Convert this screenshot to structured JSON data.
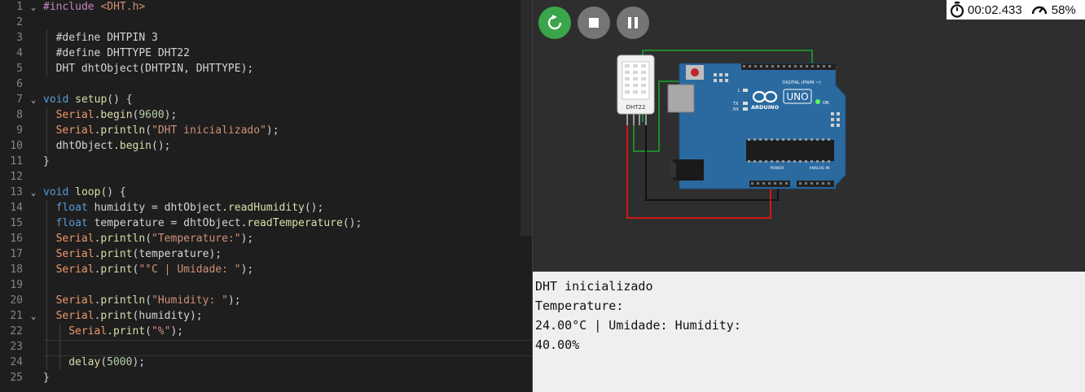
{
  "editor": {
    "line_numbers": [
      "1",
      "2",
      "3",
      "4",
      "5",
      "6",
      "7",
      "8",
      "9",
      "10",
      "11",
      "12",
      "13",
      "14",
      "15",
      "16",
      "17",
      "18",
      "19",
      "20",
      "21",
      "22",
      "23",
      "24",
      "25"
    ],
    "fold_lines": [
      1,
      7,
      13,
      21
    ],
    "lines": [
      {
        "indent": 0,
        "tokens": [
          [
            "inc",
            "#include "
          ],
          [
            "str",
            "<DHT.h>"
          ]
        ]
      },
      {
        "indent": 0,
        "tokens": []
      },
      {
        "indent": 1,
        "tokens": [
          [
            "pl",
            "#define DHTPIN 3"
          ]
        ]
      },
      {
        "indent": 1,
        "tokens": [
          [
            "pl",
            "#define DHTTYPE DHT22"
          ]
        ]
      },
      {
        "indent": 1,
        "tokens": [
          [
            "pl",
            "DHT dhtObject(DHTPIN, DHTTYPE);"
          ]
        ]
      },
      {
        "indent": 0,
        "tokens": []
      },
      {
        "indent": 0,
        "tokens": [
          [
            "kw",
            "void "
          ],
          [
            "fn",
            "setup"
          ],
          [
            "pl",
            "() {"
          ]
        ]
      },
      {
        "indent": 1,
        "tokens": [
          [
            "cls",
            "Serial"
          ],
          [
            "pl",
            "."
          ],
          [
            "fn",
            "begin"
          ],
          [
            "pl",
            "("
          ],
          [
            "num",
            "9600"
          ],
          [
            "pl",
            ");"
          ]
        ]
      },
      {
        "indent": 1,
        "tokens": [
          [
            "cls",
            "Serial"
          ],
          [
            "pl",
            "."
          ],
          [
            "fn",
            "println"
          ],
          [
            "pl",
            "("
          ],
          [
            "str",
            "\"DHT inicializado\""
          ],
          [
            "pl",
            ");"
          ]
        ]
      },
      {
        "indent": 1,
        "tokens": [
          [
            "pl",
            "dhtObject."
          ],
          [
            "fn",
            "begin"
          ],
          [
            "pl",
            "();"
          ]
        ]
      },
      {
        "indent": 0,
        "tokens": [
          [
            "pl",
            "}"
          ]
        ]
      },
      {
        "indent": 0,
        "tokens": []
      },
      {
        "indent": 0,
        "tokens": [
          [
            "kw",
            "void "
          ],
          [
            "fn",
            "loop"
          ],
          [
            "pl",
            "() {"
          ]
        ]
      },
      {
        "indent": 1,
        "tokens": [
          [
            "kw",
            "float "
          ],
          [
            "pl",
            "humidity = dhtObject."
          ],
          [
            "fn",
            "readHumidity"
          ],
          [
            "pl",
            "();"
          ]
        ]
      },
      {
        "indent": 1,
        "tokens": [
          [
            "kw",
            "float "
          ],
          [
            "pl",
            "temperature = dhtObject."
          ],
          [
            "fn",
            "readTemperature"
          ],
          [
            "pl",
            "();"
          ]
        ]
      },
      {
        "indent": 1,
        "tokens": [
          [
            "cls",
            "Serial"
          ],
          [
            "pl",
            "."
          ],
          [
            "fn",
            "println"
          ],
          [
            "pl",
            "("
          ],
          [
            "str",
            "\"Temperature:\""
          ],
          [
            "pl",
            ");"
          ]
        ]
      },
      {
        "indent": 1,
        "tokens": [
          [
            "cls",
            "Serial"
          ],
          [
            "pl",
            "."
          ],
          [
            "fn",
            "print"
          ],
          [
            "pl",
            "(temperature);"
          ]
        ]
      },
      {
        "indent": 1,
        "tokens": [
          [
            "cls",
            "Serial"
          ],
          [
            "pl",
            "."
          ],
          [
            "fn",
            "print"
          ],
          [
            "pl",
            "("
          ],
          [
            "str",
            "\"°C | Umidade: \""
          ],
          [
            "pl",
            ");"
          ]
        ]
      },
      {
        "indent": 0,
        "tokens": []
      },
      {
        "indent": 1,
        "tokens": [
          [
            "cls",
            "Serial"
          ],
          [
            "pl",
            "."
          ],
          [
            "fn",
            "println"
          ],
          [
            "pl",
            "("
          ],
          [
            "str",
            "\"Humidity: \""
          ],
          [
            "pl",
            ");"
          ]
        ]
      },
      {
        "indent": 1,
        "tokens": [
          [
            "cls",
            "Serial"
          ],
          [
            "pl",
            "."
          ],
          [
            "fn",
            "print"
          ],
          [
            "pl",
            "(humidity);"
          ]
        ]
      },
      {
        "indent": 2,
        "tokens": [
          [
            "cls",
            "Serial"
          ],
          [
            "pl",
            "."
          ],
          [
            "fn",
            "print"
          ],
          [
            "pl",
            "("
          ],
          [
            "str",
            "\"%\""
          ],
          [
            "pl",
            ");"
          ]
        ]
      },
      {
        "indent": 2,
        "tokens": []
      },
      {
        "indent": 2,
        "tokens": [
          [
            "fn",
            "delay"
          ],
          [
            "pl",
            "("
          ],
          [
            "num",
            "5000"
          ],
          [
            "pl",
            ");"
          ]
        ]
      },
      {
        "indent": 0,
        "tokens": [
          [
            "pl",
            "}"
          ]
        ]
      }
    ]
  },
  "toolbar": {
    "restart_icon": "restart-icon",
    "stop_icon": "stop-icon",
    "pause_icon": "pause-icon",
    "timer": "00:02.433",
    "speed": "58%"
  },
  "circuit": {
    "sensor_label": "DHT22",
    "board_brand": "ARDUINO",
    "board_model": "UNO",
    "on_label": "ON",
    "digital_label": "DIGITAL (PWM ~)",
    "power_label": "POWER",
    "analog_label": "ANALOG IN",
    "led_labels": [
      "L",
      "TX",
      "RX"
    ]
  },
  "serial_monitor": {
    "lines": [
      "DHT inicializado",
      "Temperature:",
      "24.00°C | Umidade: Humidity:",
      "40.00%"
    ]
  },
  "colors": {
    "restart_button": "#3aa54a",
    "board": "#2b6aa0",
    "wire_green": "#1e8a2a",
    "wire_black": "#111111",
    "wire_red": "#d01818"
  }
}
